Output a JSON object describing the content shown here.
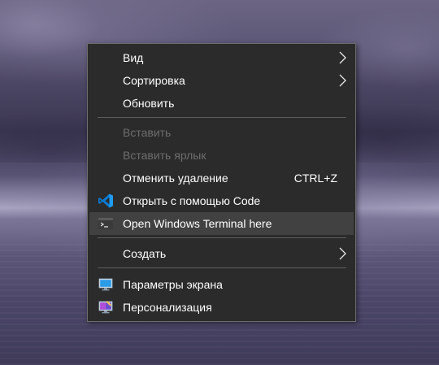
{
  "context_menu": {
    "items": [
      {
        "label": "Вид",
        "submenu": true,
        "icon": ""
      },
      {
        "label": "Сортировка",
        "submenu": true,
        "icon": ""
      },
      {
        "label": "Обновить",
        "submenu": false,
        "icon": ""
      },
      {
        "label": "Вставить",
        "disabled": true,
        "icon": ""
      },
      {
        "label": "Вставить ярлык",
        "disabled": true,
        "icon": ""
      },
      {
        "label": "Отменить удаление",
        "shortcut": "CTRL+Z",
        "icon": ""
      },
      {
        "label": "Открыть с помощью Code",
        "icon": "vscode-icon"
      },
      {
        "label": "Open Windows Terminal here",
        "icon": "terminal-icon",
        "highlighted": true
      },
      {
        "label": "Создать",
        "submenu": true,
        "icon": ""
      },
      {
        "label": "Параметры экрана",
        "icon": "display-settings-icon"
      },
      {
        "label": "Персонализация",
        "icon": "personalization-icon"
      }
    ]
  },
  "colors": {
    "menu_background": "#2b2b2b",
    "menu_border": "#6d6d6d",
    "highlight": "#414141",
    "disabled_text": "#6d6d6d",
    "vscode_blue": "#0a7ad4",
    "display_icon_blue": "#2b9be6"
  }
}
